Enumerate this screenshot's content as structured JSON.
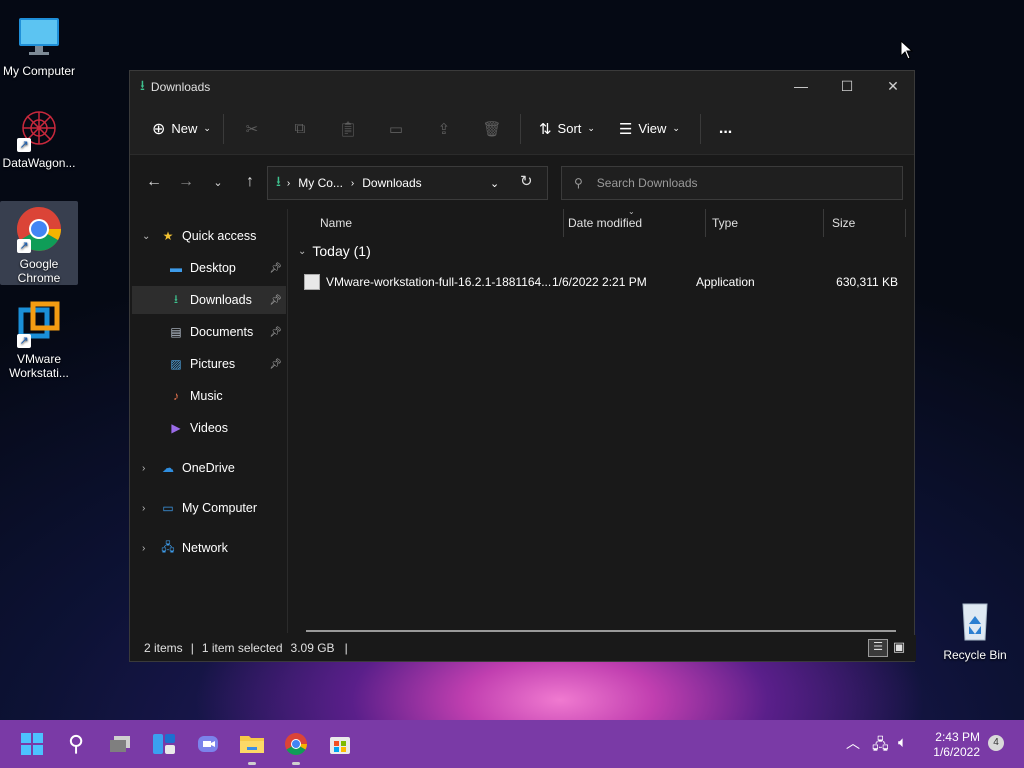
{
  "desktop": {
    "icons": [
      {
        "label": "My Computer"
      },
      {
        "label": "DataWagon..."
      },
      {
        "label": "Google Chrome"
      },
      {
        "label": "VMware Workstati..."
      },
      {
        "label": "Recycle Bin"
      }
    ]
  },
  "window": {
    "title": "Downloads",
    "toolbar": {
      "new": "New",
      "sort": "Sort",
      "view": "View",
      "more": "..."
    },
    "address": {
      "root": "My Co...",
      "current": "Downloads"
    },
    "search": {
      "placeholder": "Search Downloads"
    },
    "sidebar": {
      "quick_access": "Quick access",
      "items": [
        "Desktop",
        "Downloads",
        "Documents",
        "Pictures",
        "Music",
        "Videos"
      ],
      "onedrive": "OneDrive",
      "my_computer": "My Computer",
      "network": "Network"
    },
    "columns": {
      "name": "Name",
      "date": "Date modified",
      "type": "Type",
      "size": "Size"
    },
    "group": "Today (1)",
    "files": [
      {
        "name": "VMware-workstation-full-16.2.1-1881164...",
        "date": "1/6/2022 2:21 PM",
        "type": "Application",
        "size": "630,311 KB"
      }
    ],
    "status": {
      "items": "2 items",
      "selected": "1 item selected",
      "size": "3.09 GB"
    }
  },
  "taskbar": {
    "time": "2:43 PM",
    "date": "1/6/2022",
    "badge": "4"
  },
  "colors": {
    "accent": "#7a3aa6",
    "folder_green": "#3ec28f",
    "window_bg": "#191919"
  }
}
